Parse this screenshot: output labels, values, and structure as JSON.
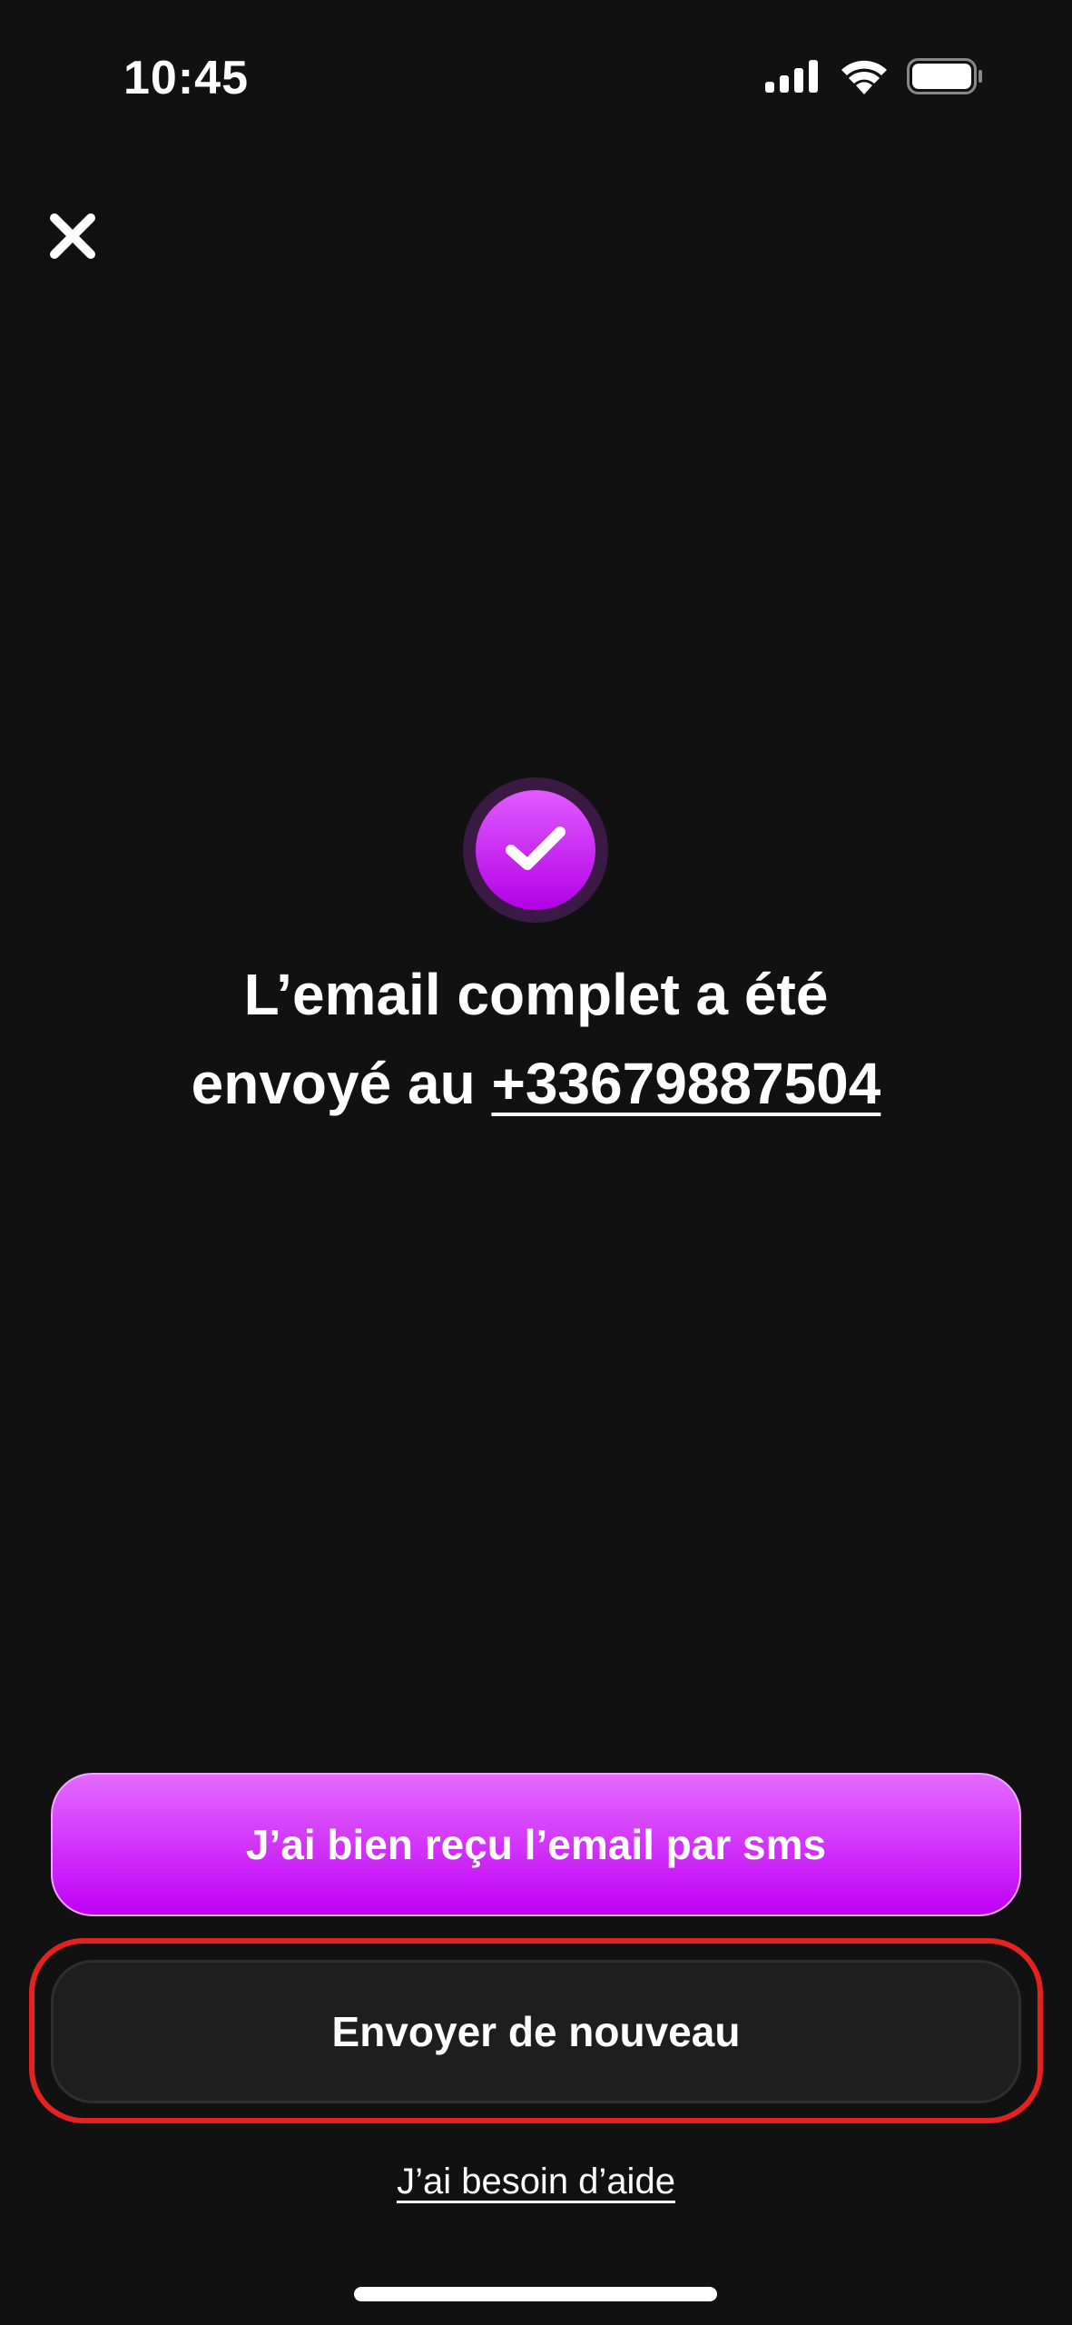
{
  "status_bar": {
    "time": "10:45",
    "icons": [
      "cellular-signal-icon",
      "wifi-icon",
      "battery-icon"
    ]
  },
  "header": {
    "close_icon": "close-icon"
  },
  "confirmation": {
    "icon": "check-icon",
    "message_line1": "L’email complet a été",
    "message_prefix": "envoyé au ",
    "phone_number": "+33679887504"
  },
  "actions": {
    "primary_label": "J’ai bien reçu l’email par sms",
    "secondary_label": "Envoyer de nouveau",
    "help_label": "J’ai besoin d’aide"
  },
  "colors": {
    "background": "#111111",
    "accent": "#c000f5",
    "accent_light": "#e46aff",
    "highlight": "#e52121"
  }
}
